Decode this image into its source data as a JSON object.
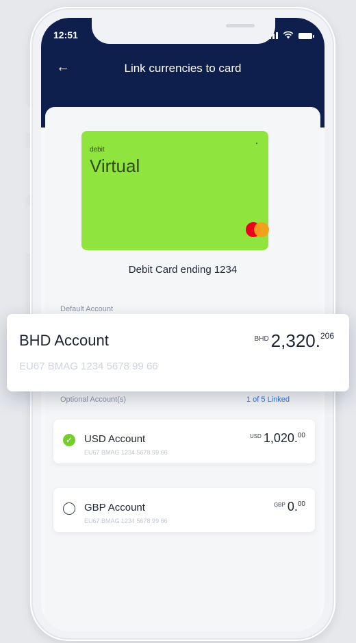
{
  "status_bar": {
    "time": "12:51"
  },
  "header": {
    "title": "Link currencies to card"
  },
  "card": {
    "type": "debit",
    "name": "Virtual",
    "caption": "Debit Card ending 1234"
  },
  "default_section": {
    "label": "Default Account",
    "account": {
      "name": "BHD Account",
      "iban": "EU67 BMAG 1234 5678 99 66",
      "currency": "BHD",
      "amount": "2,320.",
      "decimals": "206"
    }
  },
  "optional_section": {
    "label": "Optional Account(s)",
    "linked_text": "1 of 5 Linked",
    "accounts": [
      {
        "name": "USD Account",
        "iban": "EU67 BMAG 1234 5678 99 66",
        "currency": "USD",
        "amount": "1,020.",
        "decimals": "00",
        "selected": true
      },
      {
        "name": "GBP Account",
        "iban": "EU67 BMAG 1234 5678 99 66",
        "currency": "GBP",
        "amount": "0.",
        "decimals": "00",
        "selected": false
      }
    ]
  },
  "colors": {
    "header_bg": "#0e1f4d",
    "card_green": "#8fe53d",
    "check_green": "#74cf2d",
    "link_blue": "#2e73e6"
  }
}
